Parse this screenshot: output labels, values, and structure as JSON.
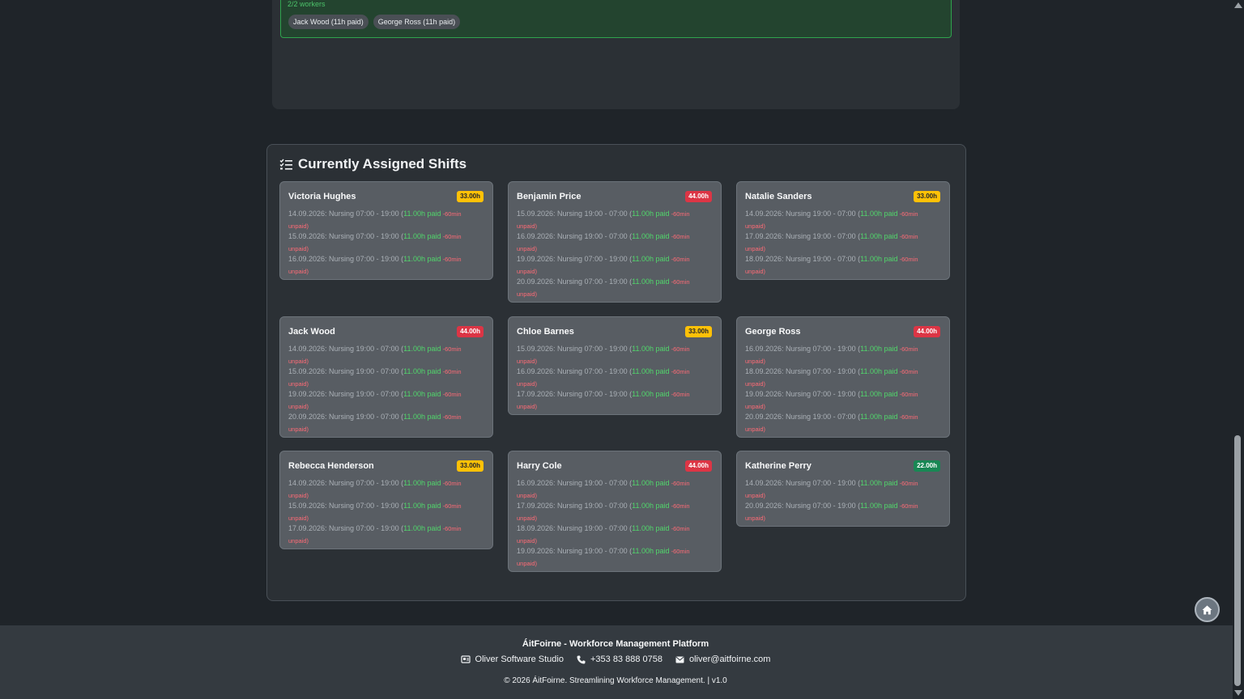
{
  "coverage": {
    "count": "2/2 workers",
    "chips": [
      "Jack Wood (11h paid)",
      "George Ross (11h paid)"
    ]
  },
  "section": {
    "title": "Currently Assigned Shifts",
    "icon": "list-check-icon"
  },
  "cards": [
    {
      "name": "Victoria Hughes",
      "hours": "33.00h",
      "badge_color": "yellow",
      "shifts": [
        {
          "text": "14.09.2026: Nursing 07:00 - 19:00 (",
          "paid": "11.00h paid",
          "break": " -60min",
          "unpaid": "unpaid)"
        },
        {
          "text": "15.09.2026: Nursing 07:00 - 19:00 (",
          "paid": "11.00h paid",
          "break": " -60min",
          "unpaid": "unpaid)"
        },
        {
          "text": "16.09.2026: Nursing 07:00 - 19:00 (",
          "paid": "11.00h paid",
          "break": " -60min",
          "unpaid": "unpaid)"
        }
      ]
    },
    {
      "name": "Benjamin Price",
      "hours": "44.00h",
      "badge_color": "red",
      "shifts": [
        {
          "text": "15.09.2026: Nursing 19:00 - 07:00 (",
          "paid": "11.00h paid",
          "break": " -60min",
          "unpaid": "unpaid)"
        },
        {
          "text": "16.09.2026: Nursing 19:00 - 07:00 (",
          "paid": "11.00h paid",
          "break": " -60min",
          "unpaid": "unpaid)"
        },
        {
          "text": "19.09.2026: Nursing 07:00 - 19:00 (",
          "paid": "11.00h paid",
          "break": " -60min",
          "unpaid": "unpaid)"
        },
        {
          "text": "20.09.2026: Nursing 07:00 - 19:00 (",
          "paid": "11.00h paid",
          "break": " -60min",
          "unpaid": "unpaid)"
        }
      ]
    },
    {
      "name": "Natalie Sanders",
      "hours": "33.00h",
      "badge_color": "yellow",
      "shifts": [
        {
          "text": "14.09.2026: Nursing 19:00 - 07:00 (",
          "paid": "11.00h paid",
          "break": " -60min",
          "unpaid": "unpaid)"
        },
        {
          "text": "17.09.2026: Nursing 19:00 - 07:00 (",
          "paid": "11.00h paid",
          "break": " -60min",
          "unpaid": "unpaid)"
        },
        {
          "text": "18.09.2026: Nursing 19:00 - 07:00 (",
          "paid": "11.00h paid",
          "break": " -60min",
          "unpaid": "unpaid)"
        }
      ]
    },
    {
      "name": "Jack Wood",
      "hours": "44.00h",
      "badge_color": "red",
      "shifts": [
        {
          "text": "14.09.2026: Nursing 19:00 - 07:00 (",
          "paid": "11.00h paid",
          "break": " -60min",
          "unpaid": "unpaid)"
        },
        {
          "text": "15.09.2026: Nursing 19:00 - 07:00 (",
          "paid": "11.00h paid",
          "break": " -60min",
          "unpaid": "unpaid)"
        },
        {
          "text": "19.09.2026: Nursing 19:00 - 07:00 (",
          "paid": "11.00h paid",
          "break": " -60min",
          "unpaid": "unpaid)"
        },
        {
          "text": "20.09.2026: Nursing 19:00 - 07:00 (",
          "paid": "11.00h paid",
          "break": " -60min",
          "unpaid": "unpaid)"
        }
      ]
    },
    {
      "name": "Chloe Barnes",
      "hours": "33.00h",
      "badge_color": "yellow",
      "shifts": [
        {
          "text": "15.09.2026: Nursing 07:00 - 19:00 (",
          "paid": "11.00h paid",
          "break": " -60min",
          "unpaid": "unpaid)"
        },
        {
          "text": "16.09.2026: Nursing 07:00 - 19:00 (",
          "paid": "11.00h paid",
          "break": " -60min",
          "unpaid": "unpaid)"
        },
        {
          "text": "17.09.2026: Nursing 07:00 - 19:00 (",
          "paid": "11.00h paid",
          "break": " -60min",
          "unpaid": "unpaid)"
        }
      ]
    },
    {
      "name": "George Ross",
      "hours": "44.00h",
      "badge_color": "red",
      "shifts": [
        {
          "text": "16.09.2026: Nursing 07:00 - 19:00 (",
          "paid": "11.00h paid",
          "break": " -60min",
          "unpaid": "unpaid)"
        },
        {
          "text": "18.09.2026: Nursing 07:00 - 19:00 (",
          "paid": "11.00h paid",
          "break": " -60min",
          "unpaid": "unpaid)"
        },
        {
          "text": "19.09.2026: Nursing 07:00 - 19:00 (",
          "paid": "11.00h paid",
          "break": " -60min",
          "unpaid": "unpaid)"
        },
        {
          "text": "20.09.2026: Nursing 19:00 - 07:00 (",
          "paid": "11.00h paid",
          "break": " -60min",
          "unpaid": "unpaid)"
        }
      ]
    },
    {
      "name": "Rebecca Henderson",
      "hours": "33.00h",
      "badge_color": "yellow",
      "shifts": [
        {
          "text": "14.09.2026: Nursing 07:00 - 19:00 (",
          "paid": "11.00h paid",
          "break": " -60min",
          "unpaid": "unpaid)"
        },
        {
          "text": "15.09.2026: Nursing 07:00 - 19:00 (",
          "paid": "11.00h paid",
          "break": " -60min",
          "unpaid": "unpaid)"
        },
        {
          "text": "17.09.2026: Nursing 07:00 - 19:00 (",
          "paid": "11.00h paid",
          "break": " -60min",
          "unpaid": "unpaid)"
        }
      ]
    },
    {
      "name": "Harry Cole",
      "hours": "44.00h",
      "badge_color": "red",
      "shifts": [
        {
          "text": "16.09.2026: Nursing 19:00 - 07:00 (",
          "paid": "11.00h paid",
          "break": " -60min",
          "unpaid": "unpaid)"
        },
        {
          "text": "17.09.2026: Nursing 19:00 - 07:00 (",
          "paid": "11.00h paid",
          "break": " -60min",
          "unpaid": "unpaid)"
        },
        {
          "text": "18.09.2026: Nursing 19:00 - 07:00 (",
          "paid": "11.00h paid",
          "break": " -60min",
          "unpaid": "unpaid)"
        },
        {
          "text": "19.09.2026: Nursing 19:00 - 07:00 (",
          "paid": "11.00h paid",
          "break": " -60min",
          "unpaid": "unpaid)"
        }
      ]
    },
    {
      "name": "Katherine Perry",
      "hours": "22.00h",
      "badge_color": "green",
      "shifts": [
        {
          "text": "14.09.2026: Nursing 07:00 - 19:00 (",
          "paid": "11.00h paid",
          "break": " -60min",
          "unpaid": "unpaid)"
        },
        {
          "text": "20.09.2026: Nursing 07:00 - 19:00 (",
          "paid": "11.00h paid",
          "break": " -60min",
          "unpaid": "unpaid)"
        }
      ]
    }
  ],
  "fab": {
    "home_icon": "home-icon",
    "up_icon": "arrow-up-icon",
    "back_icon": "arrow-left-icon"
  },
  "footer": {
    "title": "ÁitFoirne - Workforce Management Platform",
    "company": "Oliver Software Studio",
    "phone": "+353 83 888 0758",
    "email": "oliver@aitfoirne.com",
    "copyright": "© 2026 ÁitFoirne. Streamlining Workforce Management. | v1.0"
  },
  "colors": {
    "background": "#1f2429",
    "panel": "#2b3035",
    "card": "#585d63",
    "paid": "#51d66b",
    "unpaid": "#ff6b76",
    "badge_yellow": "#ffc107",
    "badge_red": "#dc3545",
    "badge_green": "#198754",
    "primary": "#0d6efd"
  }
}
